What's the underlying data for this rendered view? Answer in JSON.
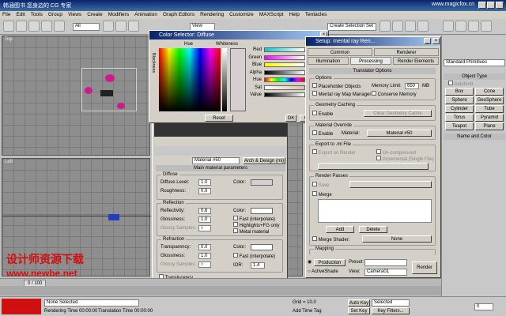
{
  "app": {
    "title_left": "韩涵图书 您身边的 CG 专家",
    "title_right": "www.magicfox.cn"
  },
  "menu": [
    "File",
    "Edit",
    "Tools",
    "Group",
    "Views",
    "Create",
    "Modifiers",
    "Animation",
    "Graph Editors",
    "Rendering",
    "Customize",
    "MAXScript",
    "Help",
    "Tentacles"
  ],
  "toolbar": {
    "filter": "All",
    "view": "View",
    "selection_set": "Create Selection Set"
  },
  "viewports": {
    "top": "Top",
    "left": "Left"
  },
  "color_selector": {
    "title": "Color Selector: Diffuse",
    "hue_label": "Hue",
    "whiteness_label": "Whiteness",
    "blackness_label": "Blackness",
    "channels": [
      {
        "label": "Red",
        "value": "0.842"
      },
      {
        "label": "Green",
        "value": "0.807"
      },
      {
        "label": "Blue",
        "value": "0.813"
      },
      {
        "label": "Alpha",
        "value": "1.0"
      },
      {
        "label": "Hue",
        "value": "0.122"
      },
      {
        "label": "Sat",
        "value": "0.043"
      },
      {
        "label": "Value",
        "value": "0.86"
      }
    ],
    "reset": "Reset",
    "ok": "OK",
    "cancel": "Cancel"
  },
  "material_editor": {
    "material_name": "Material #50",
    "type": "Arch & Design (mi)",
    "rollout": "Main material parameters",
    "diffuse": {
      "group": "Diffuse",
      "level_label": "Diffuse Level:",
      "level": "1.0",
      "roughness_label": "Roughness:",
      "roughness": "0.0",
      "color_label": "Color:"
    },
    "reflection": {
      "group": "Reflection",
      "reflectivity_label": "Reflectivity:",
      "reflectivity": "0.6",
      "color_label": "Color:",
      "glossiness_label": "Glossiness:",
      "glossiness": "1.0",
      "glossy_samples_label": "Glossy Samples:",
      "glossy_samples": "8",
      "fast_interp": "Fast (interpolate)",
      "highlights_fg": "Highlights+FG only",
      "metal": "Metal material"
    },
    "refraction": {
      "group": "Refraction",
      "transparency_label": "Transparency:",
      "transparency": "0.0",
      "color_label": "Color:",
      "glossiness_label": "Glossiness:",
      "glossiness": "1.0",
      "glossy_samples_label": "Glossy Samples:",
      "glossy_samples": "8",
      "fast_interp": "Fast (interpolate)",
      "ior_label": "IOR:",
      "ior": "1.4"
    },
    "translucency": "Translucency"
  },
  "render_setup": {
    "title": "Setup: mental ray Ren...",
    "tabs_top": [
      "Common",
      "Renderer"
    ],
    "tabs_bottom": [
      "Illumination",
      "Processing",
      "Render Elements"
    ],
    "rollout": "Translator Options",
    "options_group": "Options",
    "placeholder": "Placeholder Objects",
    "memory_limit_label": "Memory Limit:",
    "memory_limit": "650",
    "memory_unit": "MB",
    "map_manager": "Mental ray Map Manager",
    "conserve_memory": "Conserve Memory",
    "geometry_caching": "Geometry Caching",
    "enable": "Enable",
    "clear_cache": "Clear Geometry Cache",
    "material_override": "Material Override",
    "override_enable": "Enable",
    "material_label": "Material:",
    "material": "Material #50",
    "export_mi": "Export to .mi File",
    "export_on_render": "Export on Render",
    "uncompressed": "Un-compressed",
    "incremental": "Incremental (Single File)",
    "render_passes": "Render Passes",
    "save": "Save",
    "merge": "Merge",
    "add": "Add",
    "delete": "Delete",
    "merge_shader": "Merge Shader:",
    "merge_shader_value": "None",
    "mapping": "Mapping",
    "production": "Production",
    "preset_label": "Preset:",
    "activeshade": "ActiveShade",
    "view_label": "View:",
    "view": "Camera01",
    "render": "Render"
  },
  "command_panel": {
    "category": "Standard Primitives",
    "object_type": "Object Type",
    "autogrid": "AutoGrid",
    "primitives": [
      "Box",
      "Cone",
      "Sphere",
      "GeoSphere",
      "Cylinder",
      "Tube",
      "Torus",
      "Pyramid",
      "Teapot",
      "Plane"
    ],
    "name_color": "Name and Color"
  },
  "status": {
    "frame": "0 / 100",
    "selection": "None Selected",
    "rendering_time": "Rendering Time  00:00:00",
    "translation_time": "Translation Time  00:00:00",
    "grid": "Grid = 10.0",
    "auto_key": "Auto Key",
    "selected": "Selected",
    "set_key": "Set Key",
    "key_filters": "Key Filters...",
    "add_time_tag": "Add Time Tag",
    "frame_number": "0"
  },
  "watermark": {
    "line1": "设计师资源下载",
    "line2": "www.newbe.net"
  },
  "colors": {
    "title_blue": "#0a246a",
    "viewport": "#8e8e8e",
    "watermark": "#d01010"
  }
}
